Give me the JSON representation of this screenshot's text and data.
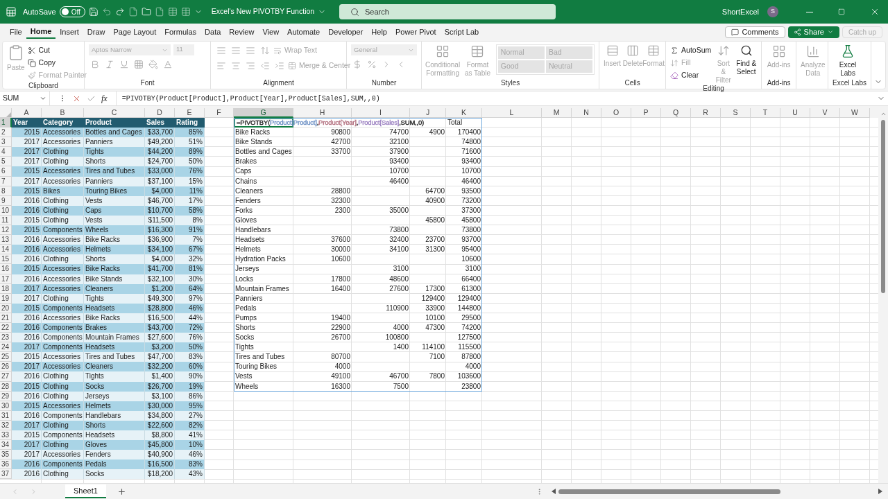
{
  "title_bar": {
    "autosave_label": "AutoSave",
    "autosave_toggle": {
      "label": "Off",
      "on": false
    },
    "document_title": "Excel's New PIVOTBY Function",
    "search_placeholder": "Search",
    "user_name": "ShortExcel",
    "avatar_initial": "S"
  },
  "menu_tabs": [
    {
      "label": "File",
      "selected": false
    },
    {
      "label": "Home",
      "selected": true
    },
    {
      "label": "Insert",
      "selected": false
    },
    {
      "label": "Draw",
      "selected": false
    },
    {
      "label": "Page Layout",
      "selected": false
    },
    {
      "label": "Formulas",
      "selected": false
    },
    {
      "label": "Data",
      "selected": false
    },
    {
      "label": "Review",
      "selected": false
    },
    {
      "label": "View",
      "selected": false
    },
    {
      "label": "Automate",
      "selected": false
    },
    {
      "label": "Developer",
      "selected": false
    },
    {
      "label": "Help",
      "selected": false
    },
    {
      "label": "Power Pivot",
      "selected": false
    },
    {
      "label": "Script Lab",
      "selected": false
    }
  ],
  "menu_actions": {
    "comments": "Comments",
    "share": "Share",
    "catch_up": {
      "label": "Catch up",
      "disabled": true
    }
  },
  "ribbon": {
    "clipboard": {
      "label": "Clipboard",
      "paste": {
        "label": "Paste",
        "disabled": true
      },
      "cut": {
        "label": "Cut",
        "disabled": false
      },
      "copy": {
        "label": "Copy",
        "disabled": false
      },
      "format_painter": {
        "label": "Format Painter",
        "disabled": true
      }
    },
    "font": {
      "label": "Font",
      "disabled": true,
      "font_name": "Aptos Narrow",
      "font_size": "11"
    },
    "alignment": {
      "label": "Alignment",
      "disabled": true,
      "wrap_text": "Wrap Text",
      "merge_center": "Merge & Center"
    },
    "number": {
      "label": "Number",
      "disabled": true,
      "format": "General"
    },
    "styles": {
      "label": "Styles",
      "disabled": true,
      "conditional_formatting": "Conditional Formatting",
      "format_as_table": "Format as Table",
      "cell_styles": [
        "Normal",
        "Bad",
        "Good",
        "Neutral"
      ]
    },
    "cells": {
      "label": "Cells",
      "disabled": true,
      "buttons": [
        "Insert",
        "Delete",
        "Format"
      ]
    },
    "editing": {
      "label": "Editing",
      "autosum": {
        "label": "AutoSum",
        "disabled": false
      },
      "fill": {
        "label": "Fill",
        "disabled": true
      },
      "clear": {
        "label": "Clear",
        "disabled": false
      },
      "sort_filter": {
        "label": "Sort & Filter",
        "disabled": true
      },
      "find_select": {
        "label": "Find & Select",
        "disabled": false
      }
    },
    "add_ins": {
      "label": "Add-ins",
      "disabled": true,
      "button": "Add-ins"
    },
    "analyze_data": {
      "label": "Analyze Data",
      "disabled": true
    },
    "excel_labs": {
      "label": "Excel Labs",
      "disabled": false,
      "button": "Excel Labs"
    }
  },
  "formula_bar": {
    "name_box": "SUM",
    "function_label": "fx",
    "formula": "=PIVOTBY(Product[Product],Product[Year],Product[Sales],SUM,,0)"
  },
  "sheet": {
    "columns": [
      {
        "label": "A",
        "selected": false
      },
      {
        "label": "B",
        "selected": false
      },
      {
        "label": "C",
        "selected": false
      },
      {
        "label": "D",
        "selected": false
      },
      {
        "label": "E",
        "selected": false
      },
      {
        "label": "F",
        "selected": false
      },
      {
        "label": "G",
        "selected": true
      },
      {
        "label": "H",
        "selected": false
      },
      {
        "label": "I",
        "selected": false
      },
      {
        "label": "J",
        "selected": false
      },
      {
        "label": "K",
        "selected": false
      },
      {
        "label": "L",
        "selected": false
      },
      {
        "label": "M",
        "selected": false
      },
      {
        "label": "N",
        "selected": false
      },
      {
        "label": "O",
        "selected": false
      },
      {
        "label": "P",
        "selected": false
      },
      {
        "label": "Q",
        "selected": false
      },
      {
        "label": "R",
        "selected": false
      },
      {
        "label": "S",
        "selected": false
      },
      {
        "label": "T",
        "selected": false
      },
      {
        "label": "U",
        "selected": false
      },
      {
        "label": "V",
        "selected": false
      },
      {
        "label": "W",
        "selected": false
      }
    ],
    "row_headers": [
      {
        "label": "1",
        "selected": true
      },
      {
        "label": "2",
        "selected": false
      },
      {
        "label": "3",
        "selected": false
      },
      {
        "label": "4",
        "selected": false
      },
      {
        "label": "5",
        "selected": false
      },
      {
        "label": "6",
        "selected": false
      },
      {
        "label": "7",
        "selected": false
      },
      {
        "label": "8",
        "selected": false
      },
      {
        "label": "9",
        "selected": false
      },
      {
        "label": "10",
        "selected": false
      },
      {
        "label": "11",
        "selected": false
      },
      {
        "label": "12",
        "selected": false
      },
      {
        "label": "13",
        "selected": false
      },
      {
        "label": "14",
        "selected": false
      },
      {
        "label": "15",
        "selected": false
      },
      {
        "label": "16",
        "selected": false
      },
      {
        "label": "17",
        "selected": false
      },
      {
        "label": "18",
        "selected": false
      },
      {
        "label": "19",
        "selected": false
      },
      {
        "label": "20",
        "selected": false
      },
      {
        "label": "21",
        "selected": false
      },
      {
        "label": "22",
        "selected": false
      },
      {
        "label": "23",
        "selected": false
      },
      {
        "label": "24",
        "selected": false
      },
      {
        "label": "25",
        "selected": false
      },
      {
        "label": "26",
        "selected": false
      },
      {
        "label": "27",
        "selected": false
      },
      {
        "label": "28",
        "selected": false
      },
      {
        "label": "29",
        "selected": false
      },
      {
        "label": "30",
        "selected": false
      },
      {
        "label": "31",
        "selected": false
      },
      {
        "label": "32",
        "selected": false
      },
      {
        "label": "33",
        "selected": false
      },
      {
        "label": "34",
        "selected": false
      },
      {
        "label": "35",
        "selected": false
      },
      {
        "label": "36",
        "selected": false
      },
      {
        "label": "37",
        "selected": false
      }
    ],
    "table": {
      "columns": [
        "Year",
        "Category",
        "Product",
        "Sales",
        "Rating"
      ],
      "rows": [
        {
          "year": "2015",
          "category": "Accessories",
          "product": "Bottles and Cages",
          "sales": "$33,700",
          "rating": "85%"
        },
        {
          "year": "2017",
          "category": "Accessories",
          "product": "Panniers",
          "sales": "$49,200",
          "rating": "51%"
        },
        {
          "year": "2017",
          "category": "Clothing",
          "product": "Tights",
          "sales": "$44,200",
          "rating": "89%"
        },
        {
          "year": "2017",
          "category": "Clothing",
          "product": "Shorts",
          "sales": "$24,700",
          "rating": "50%"
        },
        {
          "year": "2015",
          "category": "Accessories",
          "product": "Tires and Tubes",
          "sales": "$33,000",
          "rating": "76%"
        },
        {
          "year": "2017",
          "category": "Accessories",
          "product": "Panniers",
          "sales": "$37,100",
          "rating": "15%"
        },
        {
          "year": "2015",
          "category": "Bikes",
          "product": "Touring Bikes",
          "sales": "$4,000",
          "rating": "11%"
        },
        {
          "year": "2016",
          "category": "Clothing",
          "product": "Vests",
          "sales": "$46,700",
          "rating": "17%"
        },
        {
          "year": "2016",
          "category": "Clothing",
          "product": "Caps",
          "sales": "$10,700",
          "rating": "58%"
        },
        {
          "year": "2015",
          "category": "Clothing",
          "product": "Vests",
          "sales": "$11,500",
          "rating": "8%"
        },
        {
          "year": "2015",
          "category": "Components",
          "product": "Wheels",
          "sales": "$16,300",
          "rating": "91%"
        },
        {
          "year": "2016",
          "category": "Accessories",
          "product": "Bike Racks",
          "sales": "$36,900",
          "rating": "7%"
        },
        {
          "year": "2016",
          "category": "Accessories",
          "product": "Helmets",
          "sales": "$34,100",
          "rating": "67%"
        },
        {
          "year": "2016",
          "category": "Clothing",
          "product": "Shorts",
          "sales": "$4,000",
          "rating": "32%"
        },
        {
          "year": "2015",
          "category": "Accessories",
          "product": "Bike Racks",
          "sales": "$41,700",
          "rating": "81%"
        },
        {
          "year": "2016",
          "category": "Accessories",
          "product": "Bike Stands",
          "sales": "$32,100",
          "rating": "30%"
        },
        {
          "year": "2017",
          "category": "Accessories",
          "product": "Cleaners",
          "sales": "$1,200",
          "rating": "64%"
        },
        {
          "year": "2017",
          "category": "Clothing",
          "product": "Tights",
          "sales": "$49,300",
          "rating": "97%"
        },
        {
          "year": "2015",
          "category": "Components",
          "product": "Headsets",
          "sales": "$28,800",
          "rating": "46%"
        },
        {
          "year": "2016",
          "category": "Accessories",
          "product": "Bike Racks",
          "sales": "$16,500",
          "rating": "44%"
        },
        {
          "year": "2016",
          "category": "Components",
          "product": "Brakes",
          "sales": "$43,700",
          "rating": "72%"
        },
        {
          "year": "2016",
          "category": "Components",
          "product": "Mountain Frames",
          "sales": "$27,600",
          "rating": "76%"
        },
        {
          "year": "2017",
          "category": "Components",
          "product": "Headsets",
          "sales": "$3,200",
          "rating": "50%"
        },
        {
          "year": "2015",
          "category": "Accessories",
          "product": "Tires and Tubes",
          "sales": "$47,700",
          "rating": "83%"
        },
        {
          "year": "2017",
          "category": "Accessories",
          "product": "Cleaners",
          "sales": "$32,200",
          "rating": "60%"
        },
        {
          "year": "2016",
          "category": "Clothing",
          "product": "Tights",
          "sales": "$1,400",
          "rating": "90%"
        },
        {
          "year": "2015",
          "category": "Clothing",
          "product": "Socks",
          "sales": "$26,700",
          "rating": "19%"
        },
        {
          "year": "2016",
          "category": "Clothing",
          "product": "Jerseys",
          "sales": "$3,100",
          "rating": "86%"
        },
        {
          "year": "2015",
          "category": "Accessories",
          "product": "Helmets",
          "sales": "$30,000",
          "rating": "95%"
        },
        {
          "year": "2016",
          "category": "Components",
          "product": "Handlebars",
          "sales": "$34,800",
          "rating": "27%"
        },
        {
          "year": "2017",
          "category": "Clothing",
          "product": "Shorts",
          "sales": "$22,600",
          "rating": "82%"
        },
        {
          "year": "2015",
          "category": "Components",
          "product": "Headsets",
          "sales": "$8,800",
          "rating": "41%"
        },
        {
          "year": "2017",
          "category": "Clothing",
          "product": "Gloves",
          "sales": "$45,800",
          "rating": "10%"
        },
        {
          "year": "2017",
          "category": "Accessories",
          "product": "Fenders",
          "sales": "$40,900",
          "rating": "46%"
        },
        {
          "year": "2016",
          "category": "Components",
          "product": "Pedals",
          "sales": "$16,500",
          "rating": "83%"
        },
        {
          "year": "2016",
          "category": "Clothing",
          "product": "Socks",
          "sales": "$18,200",
          "rating": "43%"
        }
      ]
    },
    "pivot": {
      "formula_parts": [
        {
          "text": "=PIVOTBY("
        },
        {
          "text": "Product[Product]",
          "color": "#6b8fc4"
        },
        {
          "text": ","
        },
        {
          "text": "Product[Year]",
          "color": "#b06a7a"
        },
        {
          "text": ","
        },
        {
          "text": "Product[Sales]",
          "color": "#9a7fc0"
        },
        {
          "text": ",SUM,,0)"
        }
      ],
      "total_header": "Total",
      "rows": [
        {
          "product": "Bike Racks",
          "column_h": "90800",
          "column_i": "74700",
          "column_j": "4900",
          "total": "170400"
        },
        {
          "product": "Bike Stands",
          "column_h": "42700",
          "column_i": "32100",
          "total": "74800"
        },
        {
          "product": "Bottles and Cages",
          "column_h": "33700",
          "column_i": "37900",
          "total": "71600"
        },
        {
          "product": "Brakes",
          "column_i": "93400",
          "total": "93400"
        },
        {
          "product": "Caps",
          "column_i": "10700",
          "total": "10700"
        },
        {
          "product": "Chains",
          "column_i": "46400",
          "total": "46400"
        },
        {
          "product": "Cleaners",
          "column_h": "28800",
          "column_j": "64700",
          "total": "93500"
        },
        {
          "product": "Fenders",
          "column_h": "32300",
          "column_j": "40900",
          "total": "73200"
        },
        {
          "product": "Forks",
          "column_h": "2300",
          "column_i": "35000",
          "total": "37300"
        },
        {
          "product": "Gloves",
          "column_j": "45800",
          "total": "45800"
        },
        {
          "product": "Handlebars",
          "column_i": "73800",
          "total": "73800"
        },
        {
          "product": "Headsets",
          "column_h": "37600",
          "column_i": "32400",
          "column_j": "23700",
          "total": "93700"
        },
        {
          "product": "Helmets",
          "column_h": "30000",
          "column_i": "34100",
          "column_j": "31300",
          "total": "95400"
        },
        {
          "product": "Hydration Packs",
          "column_h": "10600",
          "total": "10600"
        },
        {
          "product": "Jerseys",
          "column_i": "3100",
          "total": "3100"
        },
        {
          "product": "Locks",
          "column_h": "17800",
          "column_i": "48600",
          "total": "66400"
        },
        {
          "product": "Mountain Frames",
          "column_h": "16400",
          "column_i": "27600",
          "column_j": "17300",
          "total": "61300"
        },
        {
          "product": "Panniers",
          "column_j": "129400",
          "total": "129400"
        },
        {
          "product": "Pedals",
          "column_i": "110900",
          "column_j": "33900",
          "total": "144800"
        },
        {
          "product": "Pumps",
          "column_h": "19400",
          "column_j": "10100",
          "total": "29500"
        },
        {
          "product": "Shorts",
          "column_h": "22900",
          "column_i": "4000",
          "column_j": "47300",
          "total": "74200"
        },
        {
          "product": "Socks",
          "column_h": "26700",
          "column_i": "100800",
          "total": "127500"
        },
        {
          "product": "Tights",
          "column_i": "1400",
          "column_j": "114100",
          "total": "115500"
        },
        {
          "product": "Tires and Tubes",
          "column_h": "80700",
          "column_j": "7100",
          "total": "87800"
        },
        {
          "product": "Touring Bikes",
          "column_h": "4000",
          "total": "4000"
        },
        {
          "product": "Vests",
          "column_h": "49100",
          "column_i": "46700",
          "column_j": "7800",
          "total": "103600"
        },
        {
          "product": "Wheels",
          "column_h": "16300",
          "column_i": "7500",
          "total": "23800"
        }
      ]
    }
  },
  "sheet_tabs": [
    {
      "label": "Sheet1",
      "selected": true
    }
  ]
}
